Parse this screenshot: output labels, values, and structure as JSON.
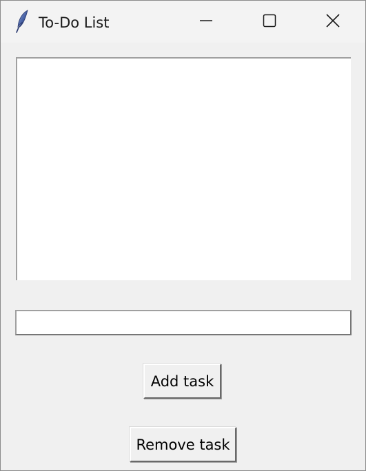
{
  "window": {
    "title": "To-Do List",
    "app_icon": "feather-icon"
  },
  "titlebar_buttons": {
    "minimize_icon": "minimize-icon",
    "maximize_icon": "maximize-icon",
    "close_icon": "close-icon"
  },
  "task_list": {
    "items": []
  },
  "task_input": {
    "value": "",
    "placeholder": ""
  },
  "buttons": {
    "add_label": "Add task",
    "remove_label": "Remove task"
  }
}
